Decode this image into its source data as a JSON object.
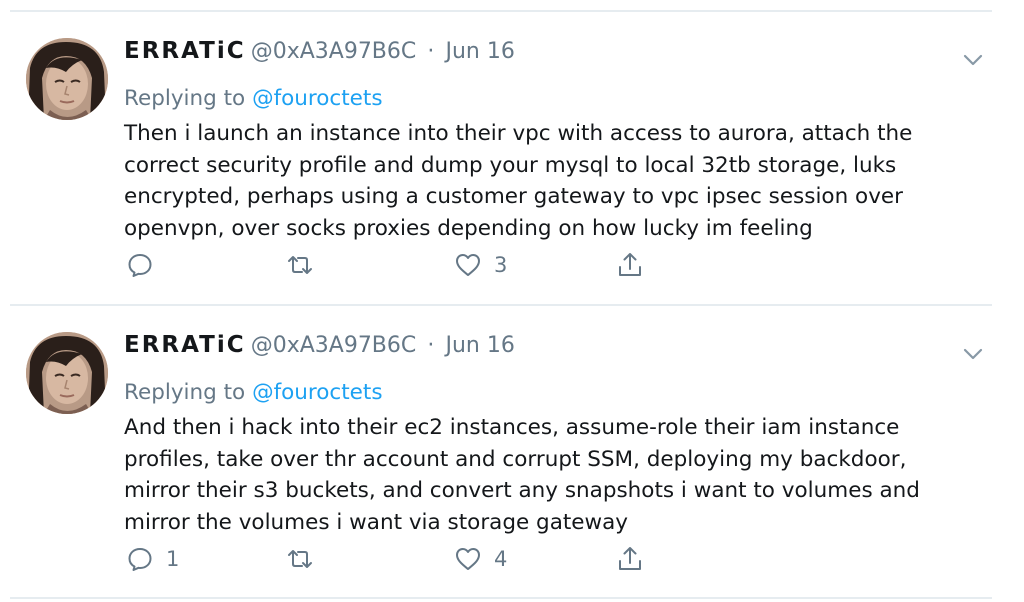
{
  "tweets": [
    {
      "display_name": "ERRATiC",
      "handle": "@0xA3A97B6C",
      "separator": "·",
      "date": "Jun 16",
      "replying_prefix": "Replying to",
      "replying_to": "@fouroctets",
      "text": "Then i launch an instance into their vpc with access to aurora, attach the correct security profile and dump your mysql to local 32tb storage, luks encrypted, perhaps using a customer gateway to vpc ipsec session over openvpn, over socks proxies depending on how lucky im feeling",
      "reply_count": "",
      "retweet_count": "",
      "like_count": "3"
    },
    {
      "display_name": "ERRATiC",
      "handle": "@0xA3A97B6C",
      "separator": "·",
      "date": "Jun 16",
      "replying_prefix": "Replying to",
      "replying_to": "@fouroctets",
      "text": "And then i hack into their ec2 instances, assume-role their iam instance profiles, take over thr account and corrupt SSM, deploying my backdoor, mirror their s3 buckets, and convert any snapshots i want to volumes and mirror the volumes i want via storage gateway",
      "reply_count": "1",
      "retweet_count": "",
      "like_count": "4"
    }
  ],
  "icons": {
    "more": "chevron-down-icon",
    "reply": "reply-icon",
    "retweet": "retweet-icon",
    "like": "heart-icon",
    "share": "share-icon"
  },
  "colors": {
    "text": "#14171a",
    "muted": "#657786",
    "link": "#1da1f2",
    "divider": "#e6ecf0"
  }
}
